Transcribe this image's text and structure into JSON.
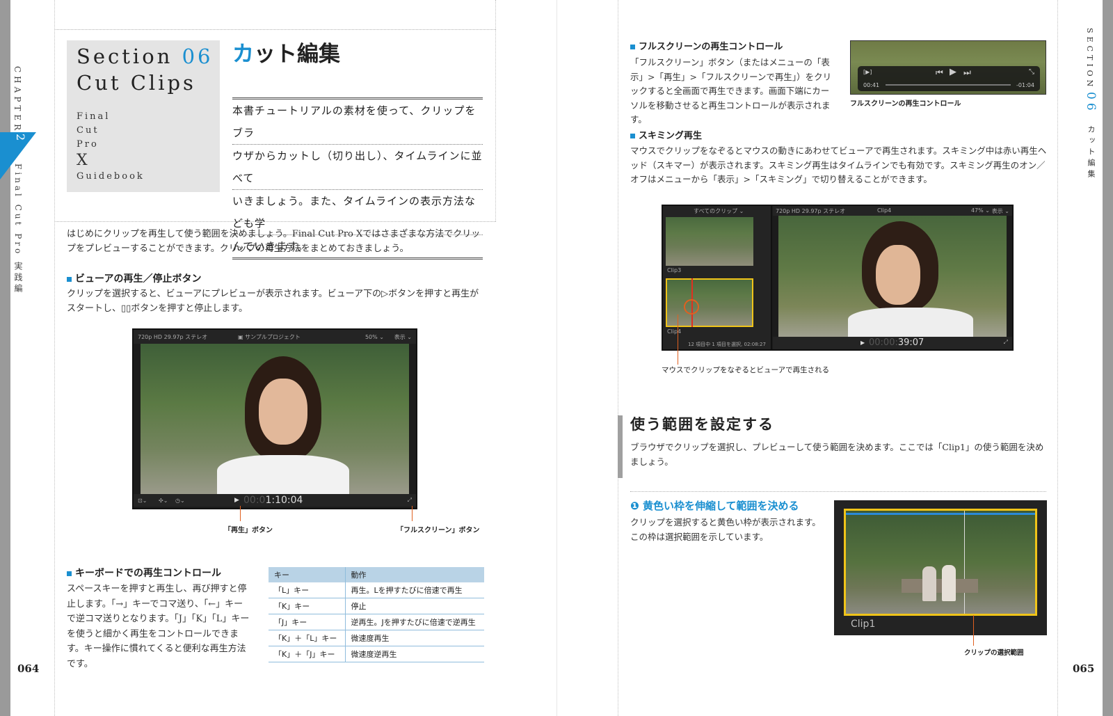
{
  "left_page": {
    "chapter_vertical": "CHAPTER",
    "chapter_num": "2",
    "chapter_title_vertical": "Final Cut Pro 実践編",
    "section_label": "Section",
    "section_num": "06",
    "section_subtitle": "Cut Clips",
    "book_words": [
      "Final",
      "Cut",
      "Pro",
      "X",
      "Guidebook"
    ],
    "title_accent": "カ",
    "title_rest": "ット編集",
    "lead_lines": [
      "本書チュートリアルの素材を使って、クリップをブラ",
      "ウザからカットし（切り出し）、タイムラインに並べて",
      "いきましょう。また、タイムラインの表示方法なども学",
      "んでいきます。"
    ],
    "intro": "はじめにクリップを再生して使う範囲を決めましょう。Final Cut Pro Xではさまざまな方法でクリップをプレビューすることができます。クリップの再生方法をまとめておきましょう。",
    "viewer_heading": "ビューアの再生／停止ボタン",
    "viewer_text": "クリップを選択すると、ビューアにプレビューが表示されます。ビューア下の▷ボタンを押すと再生がスタートし、▯▯ボタンを押すと停止します。",
    "viewer_shot": {
      "top_left": "720p HD 29.97p ステレオ",
      "top_center": "サンプルプロジェクト",
      "zoom": "50% ⌄",
      "view": "表示 ⌄",
      "timecode_dim": "00:0",
      "timecode": "1:10:04"
    },
    "caption_play": "「再生」ボタン",
    "caption_fullscreen": "「フルスクリーン」ボタン",
    "keyboard_heading": "キーボードでの再生コントロール",
    "keyboard_text": "スペースキーを押すと再生し、再び押すと停止します。「→」キーでコマ送り、「←」キーで逆コマ送りとなります。「J」「K」「L」キーを使うと細かく再生をコントロールできます。キー操作に慣れてくると便利な再生方法です。",
    "table_headers": [
      "キー",
      "動作"
    ],
    "table_rows": [
      [
        "「L」キー",
        "再生。Lを押すたびに倍速で再生"
      ],
      [
        "「K」キー",
        "停止"
      ],
      [
        "「J」キー",
        "逆再生。Jを押すたびに倍速で逆再生"
      ],
      [
        "「K」＋「L」キー",
        "微速度再生"
      ],
      [
        "「K」＋「J」キー",
        "微速度逆再生"
      ]
    ],
    "page_number": "064"
  },
  "right_page": {
    "fullscreen_heading": "フルスクリーンの再生コントロール",
    "fullscreen_text": "「フルスクリーン」ボタン（またはメニューの「表示」>「再生」>「フルスクリーンで再生」）をクリックすると全画面で再生できます。画面下端にカーソルを移動させると再生コントロールが表示されます。",
    "fs_time_left": "00:41",
    "fs_time_right": "-01:04",
    "fs_caption": "フルスクリーンの再生コントロール",
    "skimming_heading": "スキミング再生",
    "skimming_text": "マウスでクリップをなぞるとマウスの動きにあわせてビューアで再生されます。スキミング中は赤い再生ヘッド（スキマー）が表示されます。スキミング再生はタイムラインでも有効です。スキミング再生のオン／オフはメニューから「表示」>「スキミング」で切り替えることができます。",
    "skim_shot": {
      "browser_title": "すべてのクリップ ⌄",
      "clip_a": "Clip3",
      "clip_b": "Clip4",
      "browser_status": "12 項目中 1 項目を選択, 02:08:27",
      "viewer_info": "720p HD 29.97p ステレオ",
      "viewer_clip": "Clip4",
      "zoom": "47% ⌄",
      "view": "表示 ⌄",
      "timecode_dim": "00:00:",
      "timecode": "39:07"
    },
    "skim_caption": "マウスでクリップをなぞるとビューアで再生される",
    "range_heading": "使う範囲を設定する",
    "range_text": "ブラウザでクリップを選択し、プレビューして使う範囲を決めます。ここでは「Clip1」の使う範囲を決めましょう。",
    "step_num": "❶",
    "step_heading": "黄色い枠を伸縮して範囲を決める",
    "step_text": "クリップを選択すると黄色い枠が表示されます。この枠は選択範囲を示しています。",
    "clip1_label": "Clip1",
    "clip1_caption": "クリップの選択範囲",
    "side_section": "SECTION",
    "side_section_num": "06",
    "side_title": "カット編集",
    "page_number": "065"
  },
  "colors": {
    "accent": "#1a8fd0",
    "sidebar": "#9a9a9a",
    "table_header": "#b9d3e6",
    "selection_yellow": "#f0c419",
    "leader_orange": "#e06020"
  }
}
